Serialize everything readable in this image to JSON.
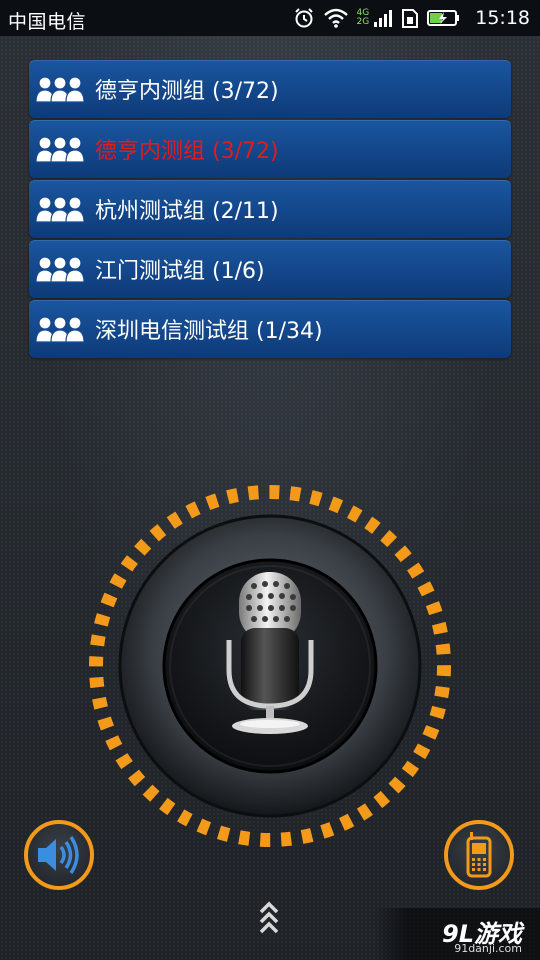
{
  "status_bar": {
    "carrier": "中国电信",
    "network_4g": "4G",
    "network_2g": "2G",
    "time": "15:18",
    "icons": [
      "alarm-icon",
      "wifi-icon",
      "signal-icon",
      "sim-icon",
      "battery-charging-icon"
    ]
  },
  "groups": [
    {
      "label": "德亨内测组 (3/72)",
      "active": false
    },
    {
      "label": "德亨内测组 (3/72)",
      "active": true
    },
    {
      "label": "杭州测试组 (2/11)",
      "active": false
    },
    {
      "label": "江门测试组 (1/6)",
      "active": false
    },
    {
      "label": "深圳电信测试组 (1/34)",
      "active": false
    }
  ],
  "colors": {
    "list_item_bg": "#14498f",
    "active_label": "#e01c1c",
    "accent_orange": "#f39a1b",
    "speaker_blue": "#3a8de0"
  },
  "watermark": {
    "logo": "9L游戏",
    "url": "91danji.com"
  }
}
